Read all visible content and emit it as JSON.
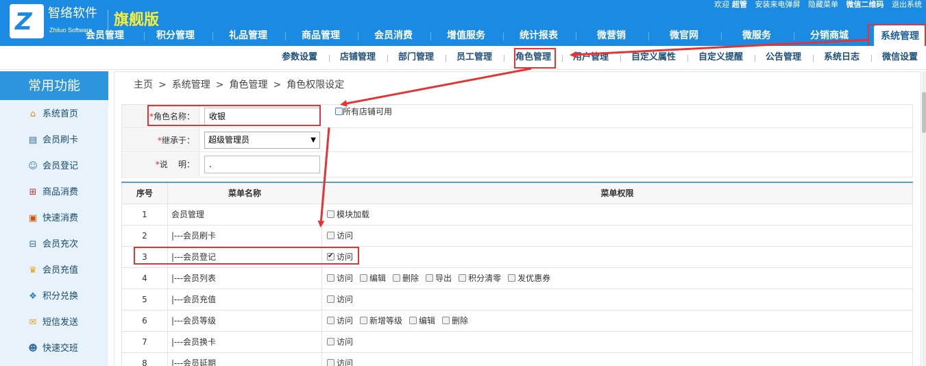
{
  "brand": {
    "name_cn": "智络软件",
    "name_en": "Zhiluo Software",
    "edition": "旗舰版",
    "logo_letter": "Z"
  },
  "topbar": {
    "welcome": "欢迎",
    "user": "超管",
    "install_popup": "安装来电弹屏",
    "hide_menu": "隐藏菜单",
    "wechat_qr": "微信二维码",
    "logout": "退出系统"
  },
  "main_nav": [
    {
      "label": "会员管理"
    },
    {
      "label": "积分管理"
    },
    {
      "label": "礼品管理"
    },
    {
      "label": "商品管理"
    },
    {
      "label": "会员消费"
    },
    {
      "label": "增值服务"
    },
    {
      "label": "统计报表"
    },
    {
      "label": "微营销"
    },
    {
      "label": "微官网"
    },
    {
      "label": "微服务"
    },
    {
      "label": "分销商城"
    },
    {
      "label": "系统管理"
    }
  ],
  "sub_nav": [
    {
      "label": "参数设置"
    },
    {
      "label": "店铺管理"
    },
    {
      "label": "部门管理"
    },
    {
      "label": "员工管理"
    },
    {
      "label": "角色管理"
    },
    {
      "label": "用户管理"
    },
    {
      "label": "自定义属性"
    },
    {
      "label": "自定义提醒"
    },
    {
      "label": "公告管理"
    },
    {
      "label": "系统日志"
    },
    {
      "label": "微信设置"
    }
  ],
  "sidebar": {
    "title": "常用功能",
    "items": [
      {
        "label": "系统首页",
        "icon": "home-icon"
      },
      {
        "label": "会员刷卡",
        "icon": "card-swipe-icon"
      },
      {
        "label": "会员登记",
        "icon": "user-register-icon"
      },
      {
        "label": "商品消费",
        "icon": "cart-icon"
      },
      {
        "label": "快速消费",
        "icon": "chart-icon"
      },
      {
        "label": "会员充次",
        "icon": "cart-recharge-icon"
      },
      {
        "label": "会员充值",
        "icon": "crown-icon"
      },
      {
        "label": "积分兑换",
        "icon": "gift-icon"
      },
      {
        "label": "短信发送",
        "icon": "envelope-icon"
      },
      {
        "label": "快速交班",
        "icon": "user-shift-icon"
      }
    ]
  },
  "breadcrumb": [
    "主页",
    "系统管理",
    "角色管理",
    "角色权限设定"
  ],
  "breadcrumb_sep": ">",
  "form": {
    "role_name": {
      "label": "角色名称：",
      "value": "收银",
      "req": "*"
    },
    "all_shops": {
      "label": "所有店铺可用",
      "checked": false
    },
    "inherit": {
      "label": "继承于：",
      "value": "超级管理员",
      "req": "*"
    },
    "desc": {
      "label": "说    明：",
      "value": ".",
      "req": "*"
    }
  },
  "table": {
    "headers": {
      "no": "序号",
      "name": "菜单名称",
      "perm": "菜单权限"
    },
    "rows": [
      {
        "no": "1",
        "name": "会员管理",
        "perms": [
          {
            "label": "模块加载",
            "checked": false
          }
        ]
      },
      {
        "no": "2",
        "name": "|---会员刷卡",
        "perms": [
          {
            "label": "访问",
            "checked": false
          }
        ]
      },
      {
        "no": "3",
        "name": "|---会员登记",
        "perms": [
          {
            "label": "访问",
            "checked": true
          }
        ]
      },
      {
        "no": "4",
        "name": "|---会员列表",
        "perms": [
          {
            "label": "访问",
            "checked": false
          },
          {
            "label": "编辑",
            "checked": false
          },
          {
            "label": "删除",
            "checked": false
          },
          {
            "label": "导出",
            "checked": false
          },
          {
            "label": "积分清零",
            "checked": false
          },
          {
            "label": "发优惠券",
            "checked": false
          }
        ]
      },
      {
        "no": "5",
        "name": "|---会员充值",
        "perms": [
          {
            "label": "访问",
            "checked": false
          }
        ]
      },
      {
        "no": "6",
        "name": "|---会员等级",
        "perms": [
          {
            "label": "访问",
            "checked": false
          },
          {
            "label": "新增等级",
            "checked": false
          },
          {
            "label": "编辑",
            "checked": false
          },
          {
            "label": "删除",
            "checked": false
          }
        ]
      },
      {
        "no": "7",
        "name": "|---会员换卡",
        "perms": [
          {
            "label": "访问",
            "checked": false
          }
        ]
      },
      {
        "no": "8",
        "name": "|---会员延期",
        "perms": [
          {
            "label": "访问",
            "checked": false
          }
        ]
      }
    ]
  },
  "colors": {
    "header_bg": "#1a8ae3",
    "edition": "#f7ee3a",
    "annotation": "#e53333",
    "sidebar_bg": "#e7f2fb"
  }
}
